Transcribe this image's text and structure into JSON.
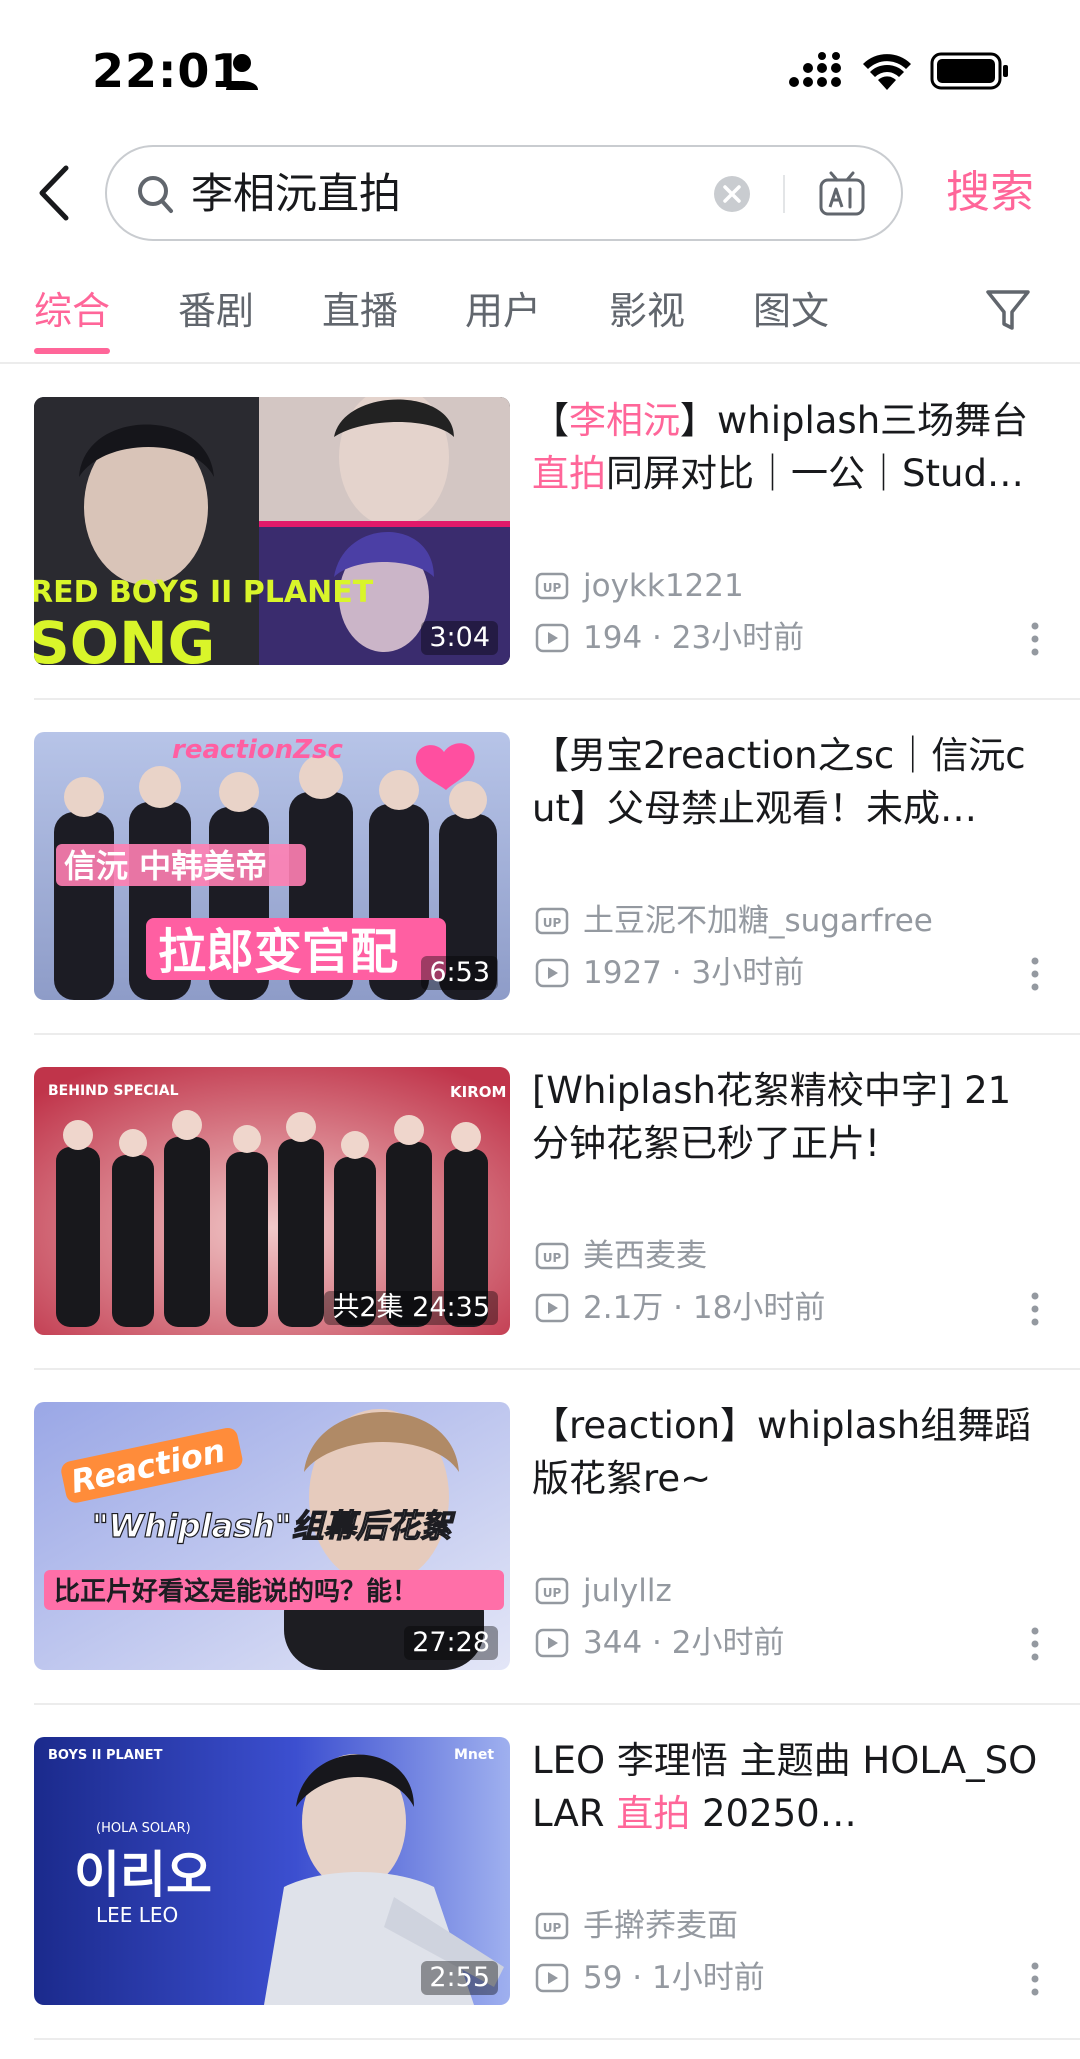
{
  "status_bar": {
    "time": "22:01",
    "icons": [
      "person-icon",
      "signal-icon",
      "wifi-icon",
      "battery-icon"
    ]
  },
  "search": {
    "query": "李相沅直拍",
    "button_label": "搜索",
    "icons": [
      "back-icon",
      "search-icon",
      "clear-icon",
      "ai-icon"
    ]
  },
  "tabs": {
    "items": [
      {
        "label": "综合",
        "active": true
      },
      {
        "label": "番剧",
        "active": false
      },
      {
        "label": "直播",
        "active": false
      },
      {
        "label": "用户",
        "active": false
      },
      {
        "label": "影视",
        "active": false
      },
      {
        "label": "图文",
        "active": false
      }
    ],
    "filter_icon": "filter-icon"
  },
  "colors": {
    "accent": "#ff6699",
    "secondary_text": "#9499a0",
    "primary_text": "#18191c"
  },
  "results": [
    {
      "title_parts": [
        {
          "text": "【",
          "hl": false
        },
        {
          "text": "李相沅",
          "hl": true
        },
        {
          "text": "】whiplash三场舞台",
          "hl": false
        },
        {
          "text": "直拍",
          "hl": true
        },
        {
          "text": "同屏对比｜一公｜Stud…",
          "hl": false
        }
      ],
      "duration": "3:04",
      "up_name": "joykk1221",
      "views": "194",
      "time_ago": "23小时前",
      "thumb_text": "RED BOYS II PLANET"
    },
    {
      "title_parts": [
        {
          "text": "【男宝2reaction之sc｜信沅cut】父母禁止观看！未成…",
          "hl": false
        }
      ],
      "duration": "6:53",
      "up_name": "土豆泥不加糖_sugarfree",
      "views": "1927",
      "time_ago": "3小时前",
      "thumb_text": "reactionZsc"
    },
    {
      "title_parts": [
        {
          "text": "[Whiplash花絮精校中字] 21分钟花絮已秒了正片!",
          "hl": false
        }
      ],
      "duration": "共2集 24:35",
      "up_name": "美西麦麦",
      "views": "2.1万",
      "time_ago": "18小时前",
      "thumb_text": "BEHIND SPECIAL"
    },
    {
      "title_parts": [
        {
          "text": "【reaction】whiplash组舞蹈版花絮re~",
          "hl": false
        }
      ],
      "duration": "27:28",
      "up_name": "julyllz",
      "views": "344",
      "time_ago": "2小时前",
      "thumb_text": "Reaction"
    },
    {
      "title_parts": [
        {
          "text": "LEO 李理悟 主题曲 HOLA_SOLAR ",
          "hl": false
        },
        {
          "text": "直拍",
          "hl": true
        },
        {
          "text": " 20250…",
          "hl": false
        }
      ],
      "duration": "2:55",
      "up_name": "手擀荞麦面",
      "views": "59",
      "time_ago": "1小时前",
      "thumb_text": "이리오"
    }
  ]
}
